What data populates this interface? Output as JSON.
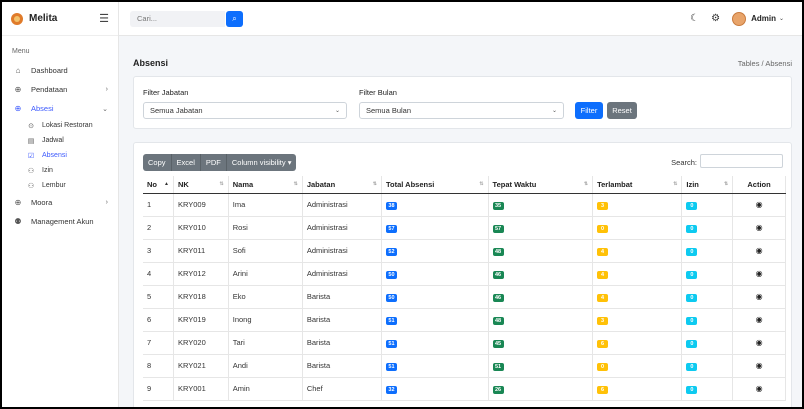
{
  "app": {
    "name": "Melita"
  },
  "sidebar": {
    "menu_heading": "Menu",
    "items": [
      {
        "label": "Dashboard",
        "icon": "home-icon",
        "glyph": "⌂"
      },
      {
        "label": "Pendataan",
        "icon": "globe-icon",
        "glyph": "⊕",
        "chevron": "›"
      },
      {
        "label": "Absesi",
        "icon": "globe-icon",
        "glyph": "⊕",
        "chevron": "⌄"
      }
    ],
    "sub_items": [
      {
        "label": "Lokasi Restoran",
        "icon": "map-pin-icon",
        "glyph": "⊙"
      },
      {
        "label": "Jadwal",
        "icon": "calendar-icon",
        "glyph": "▤"
      },
      {
        "label": "Absensi",
        "icon": "checkbox-icon",
        "glyph": "☑"
      },
      {
        "label": "Izin",
        "icon": "user-plus-icon",
        "glyph": "⚇"
      },
      {
        "label": "Lembur",
        "icon": "user-plus-icon",
        "glyph": "⚇"
      }
    ],
    "items_after": [
      {
        "label": "Moora",
        "icon": "globe-icon",
        "glyph": "⊕",
        "chevron": "›"
      },
      {
        "label": "Management Akun",
        "icon": "users-icon",
        "glyph": "⚉"
      }
    ]
  },
  "topbar": {
    "search_placeholder": "Cari...",
    "admin_label": "Admin"
  },
  "page": {
    "title": "Absensi",
    "breadcrumb": "Tables  /  Absensi"
  },
  "filters": {
    "jabatan_label": "Filter Jabatan",
    "jabatan_value": "Semua Jabatan",
    "bulan_label": "Filter Bulan",
    "bulan_value": "Semua Bulan",
    "filter_button": "Filter",
    "reset_button": "Reset"
  },
  "table_tools": {
    "copy": "Copy",
    "excel": "Excel",
    "pdf": "PDF",
    "colvis": "Column visibility ▾",
    "search_label": "Search:"
  },
  "table": {
    "headers": [
      "No",
      "NK",
      "Nama",
      "Jabatan",
      "Total Absensi",
      "Tepat Waktu",
      "Terlambat",
      "Izin",
      "Action"
    ],
    "rows": [
      {
        "no": "1",
        "nk": "KRY009",
        "nama": "Ima",
        "jabatan": "Administrasi",
        "total": "38",
        "tepat": "35",
        "terlambat": "3",
        "izin": "0"
      },
      {
        "no": "2",
        "nk": "KRY010",
        "nama": "Rosi",
        "jabatan": "Administrasi",
        "total": "57",
        "tepat": "57",
        "terlambat": "0",
        "izin": "0"
      },
      {
        "no": "3",
        "nk": "KRY011",
        "nama": "Sofi",
        "jabatan": "Administrasi",
        "total": "52",
        "tepat": "48",
        "terlambat": "4",
        "izin": "0"
      },
      {
        "no": "4",
        "nk": "KRY012",
        "nama": "Arini",
        "jabatan": "Administrasi",
        "total": "50",
        "tepat": "46",
        "terlambat": "4",
        "izin": "0"
      },
      {
        "no": "5",
        "nk": "KRY018",
        "nama": "Eko",
        "jabatan": "Barista",
        "total": "50",
        "tepat": "46",
        "terlambat": "4",
        "izin": "0"
      },
      {
        "no": "6",
        "nk": "KRY019",
        "nama": "Inong",
        "jabatan": "Barista",
        "total": "51",
        "tepat": "48",
        "terlambat": "3",
        "izin": "0"
      },
      {
        "no": "7",
        "nk": "KRY020",
        "nama": "Tari",
        "jabatan": "Barista",
        "total": "51",
        "tepat": "45",
        "terlambat": "6",
        "izin": "0"
      },
      {
        "no": "8",
        "nk": "KRY021",
        "nama": "Andi",
        "jabatan": "Barista",
        "total": "51",
        "tepat": "51",
        "terlambat": "0",
        "izin": "0"
      },
      {
        "no": "9",
        "nk": "KRY001",
        "nama": "Amin",
        "jabatan": "Chef",
        "total": "32",
        "tepat": "26",
        "terlambat": "6",
        "izin": "0"
      }
    ]
  },
  "colors": {
    "primary": "#0d6efd",
    "success": "#198754",
    "warning": "#ffc107",
    "info": "#0dcaf0",
    "secondary": "#6c757d",
    "active_nav": "#3d5afe"
  }
}
